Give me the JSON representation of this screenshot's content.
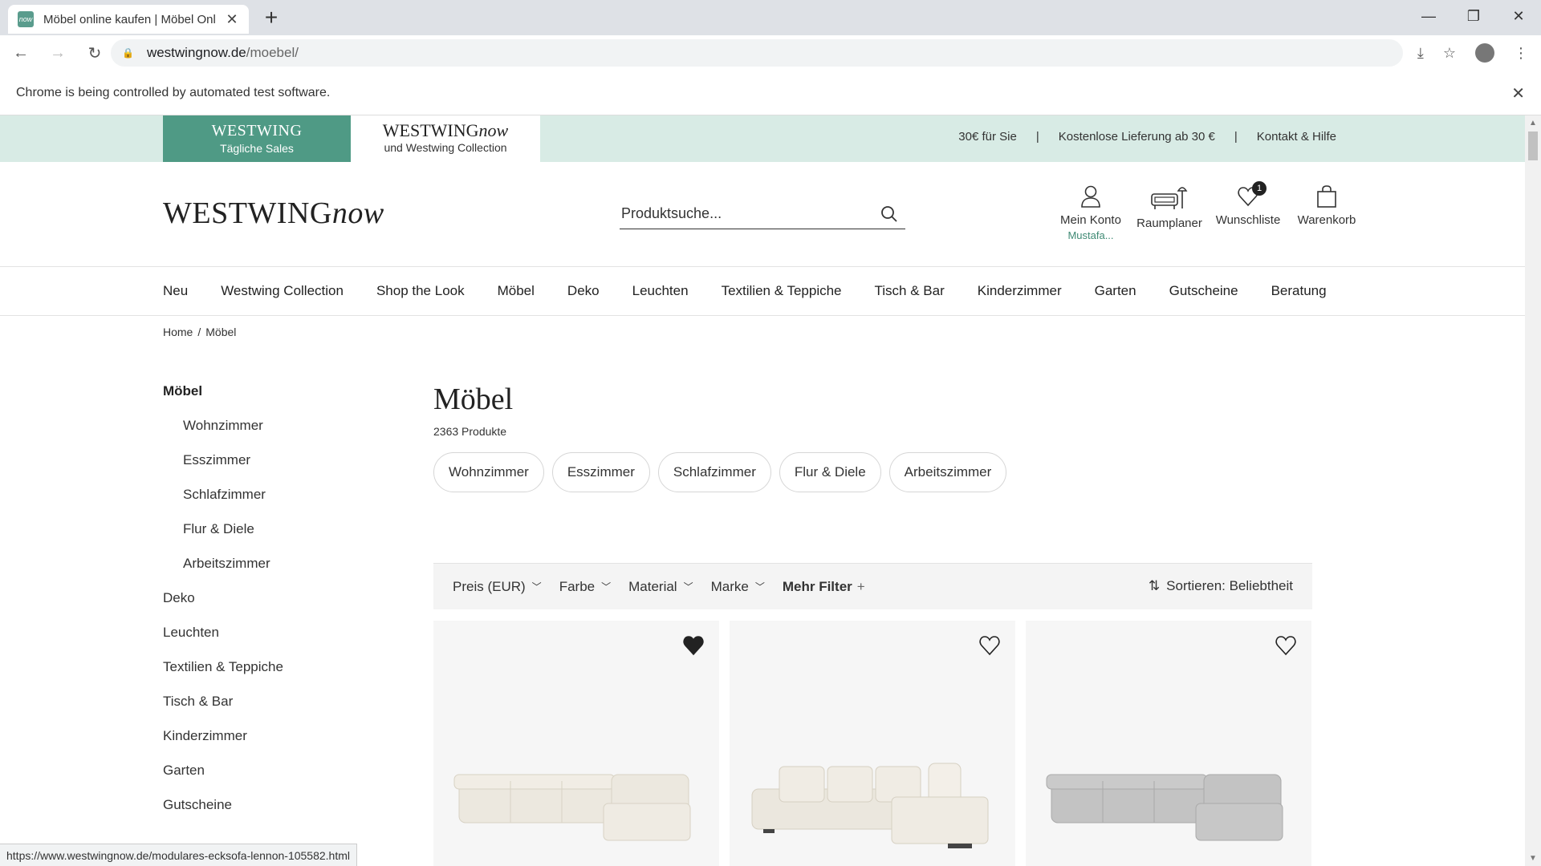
{
  "browser": {
    "tab_title": "Möbel online kaufen | Möbel Onl",
    "favicon_text": "now",
    "url_domain": "westwingnow.de",
    "url_path": "/moebel/",
    "automation_message": "Chrome is being controlled by automated test software.",
    "status_url": "https://www.westwingnow.de/modulares-ecksofa-lennon-105582.html"
  },
  "topstrip": {
    "daily_brand": "WESTWING",
    "daily_sub": "Tägliche Sales",
    "now_brand_a": "WESTWING",
    "now_brand_b": "now",
    "now_sub": "und Westwing Collection",
    "links": [
      "30€ für Sie",
      "Kostenlose Lieferung ab 30 €",
      "Kontakt & Hilfe"
    ],
    "separator": "|"
  },
  "header": {
    "logo_a": "WESTWING",
    "logo_b": "now",
    "search_placeholder": "Produktsuche...",
    "account_label": "Mein Konto",
    "account_user": "Mustafa...",
    "planner_label": "Raumplaner",
    "wishlist_label": "Wunschliste",
    "wishlist_count": "1",
    "cart_label": "Warenkorb"
  },
  "nav": [
    "Neu",
    "Westwing Collection",
    "Shop the Look",
    "Möbel",
    "Deko",
    "Leuchten",
    "Textilien & Teppiche",
    "Tisch & Bar",
    "Kinderzimmer",
    "Garten",
    "Gutscheine",
    "Beratung"
  ],
  "breadcrumb": {
    "home": "Home",
    "sep": "/",
    "current": "Möbel"
  },
  "sidebar": {
    "items": [
      {
        "label": "Möbel"
      },
      {
        "label": "Wohnzimmer"
      },
      {
        "label": "Esszimmer"
      },
      {
        "label": "Schlafzimmer"
      },
      {
        "label": "Flur & Diele"
      },
      {
        "label": "Arbeitszimmer"
      },
      {
        "label": "Deko"
      },
      {
        "label": "Leuchten"
      },
      {
        "label": "Textilien & Teppiche"
      },
      {
        "label": "Tisch & Bar"
      },
      {
        "label": "Kinderzimmer"
      },
      {
        "label": "Garten"
      },
      {
        "label": "Gutscheine"
      }
    ]
  },
  "main": {
    "title": "Möbel",
    "count": "2363 Produkte",
    "chips": [
      "Wohnzimmer",
      "Esszimmer",
      "Schlafzimmer",
      "Flur & Diele",
      "Arbeitszimmer"
    ],
    "filters": [
      "Preis (EUR)",
      "Farbe",
      "Material",
      "Marke"
    ],
    "more_filters": "Mehr Filter",
    "sort_label": "Sortieren: Beliebtheit"
  },
  "products": [
    {
      "name": "modulares-ecksofa-lennon",
      "wishlisted": true,
      "color": "#ece8df"
    },
    {
      "name": "ecksofa-creme",
      "wishlisted": false,
      "color": "#ebe7de"
    },
    {
      "name": "ecksofa-grau",
      "wishlisted": false,
      "color": "#c3c3c3"
    }
  ],
  "colors": {
    "accent": "#4f9a85",
    "strip": "#d8ebe5"
  }
}
